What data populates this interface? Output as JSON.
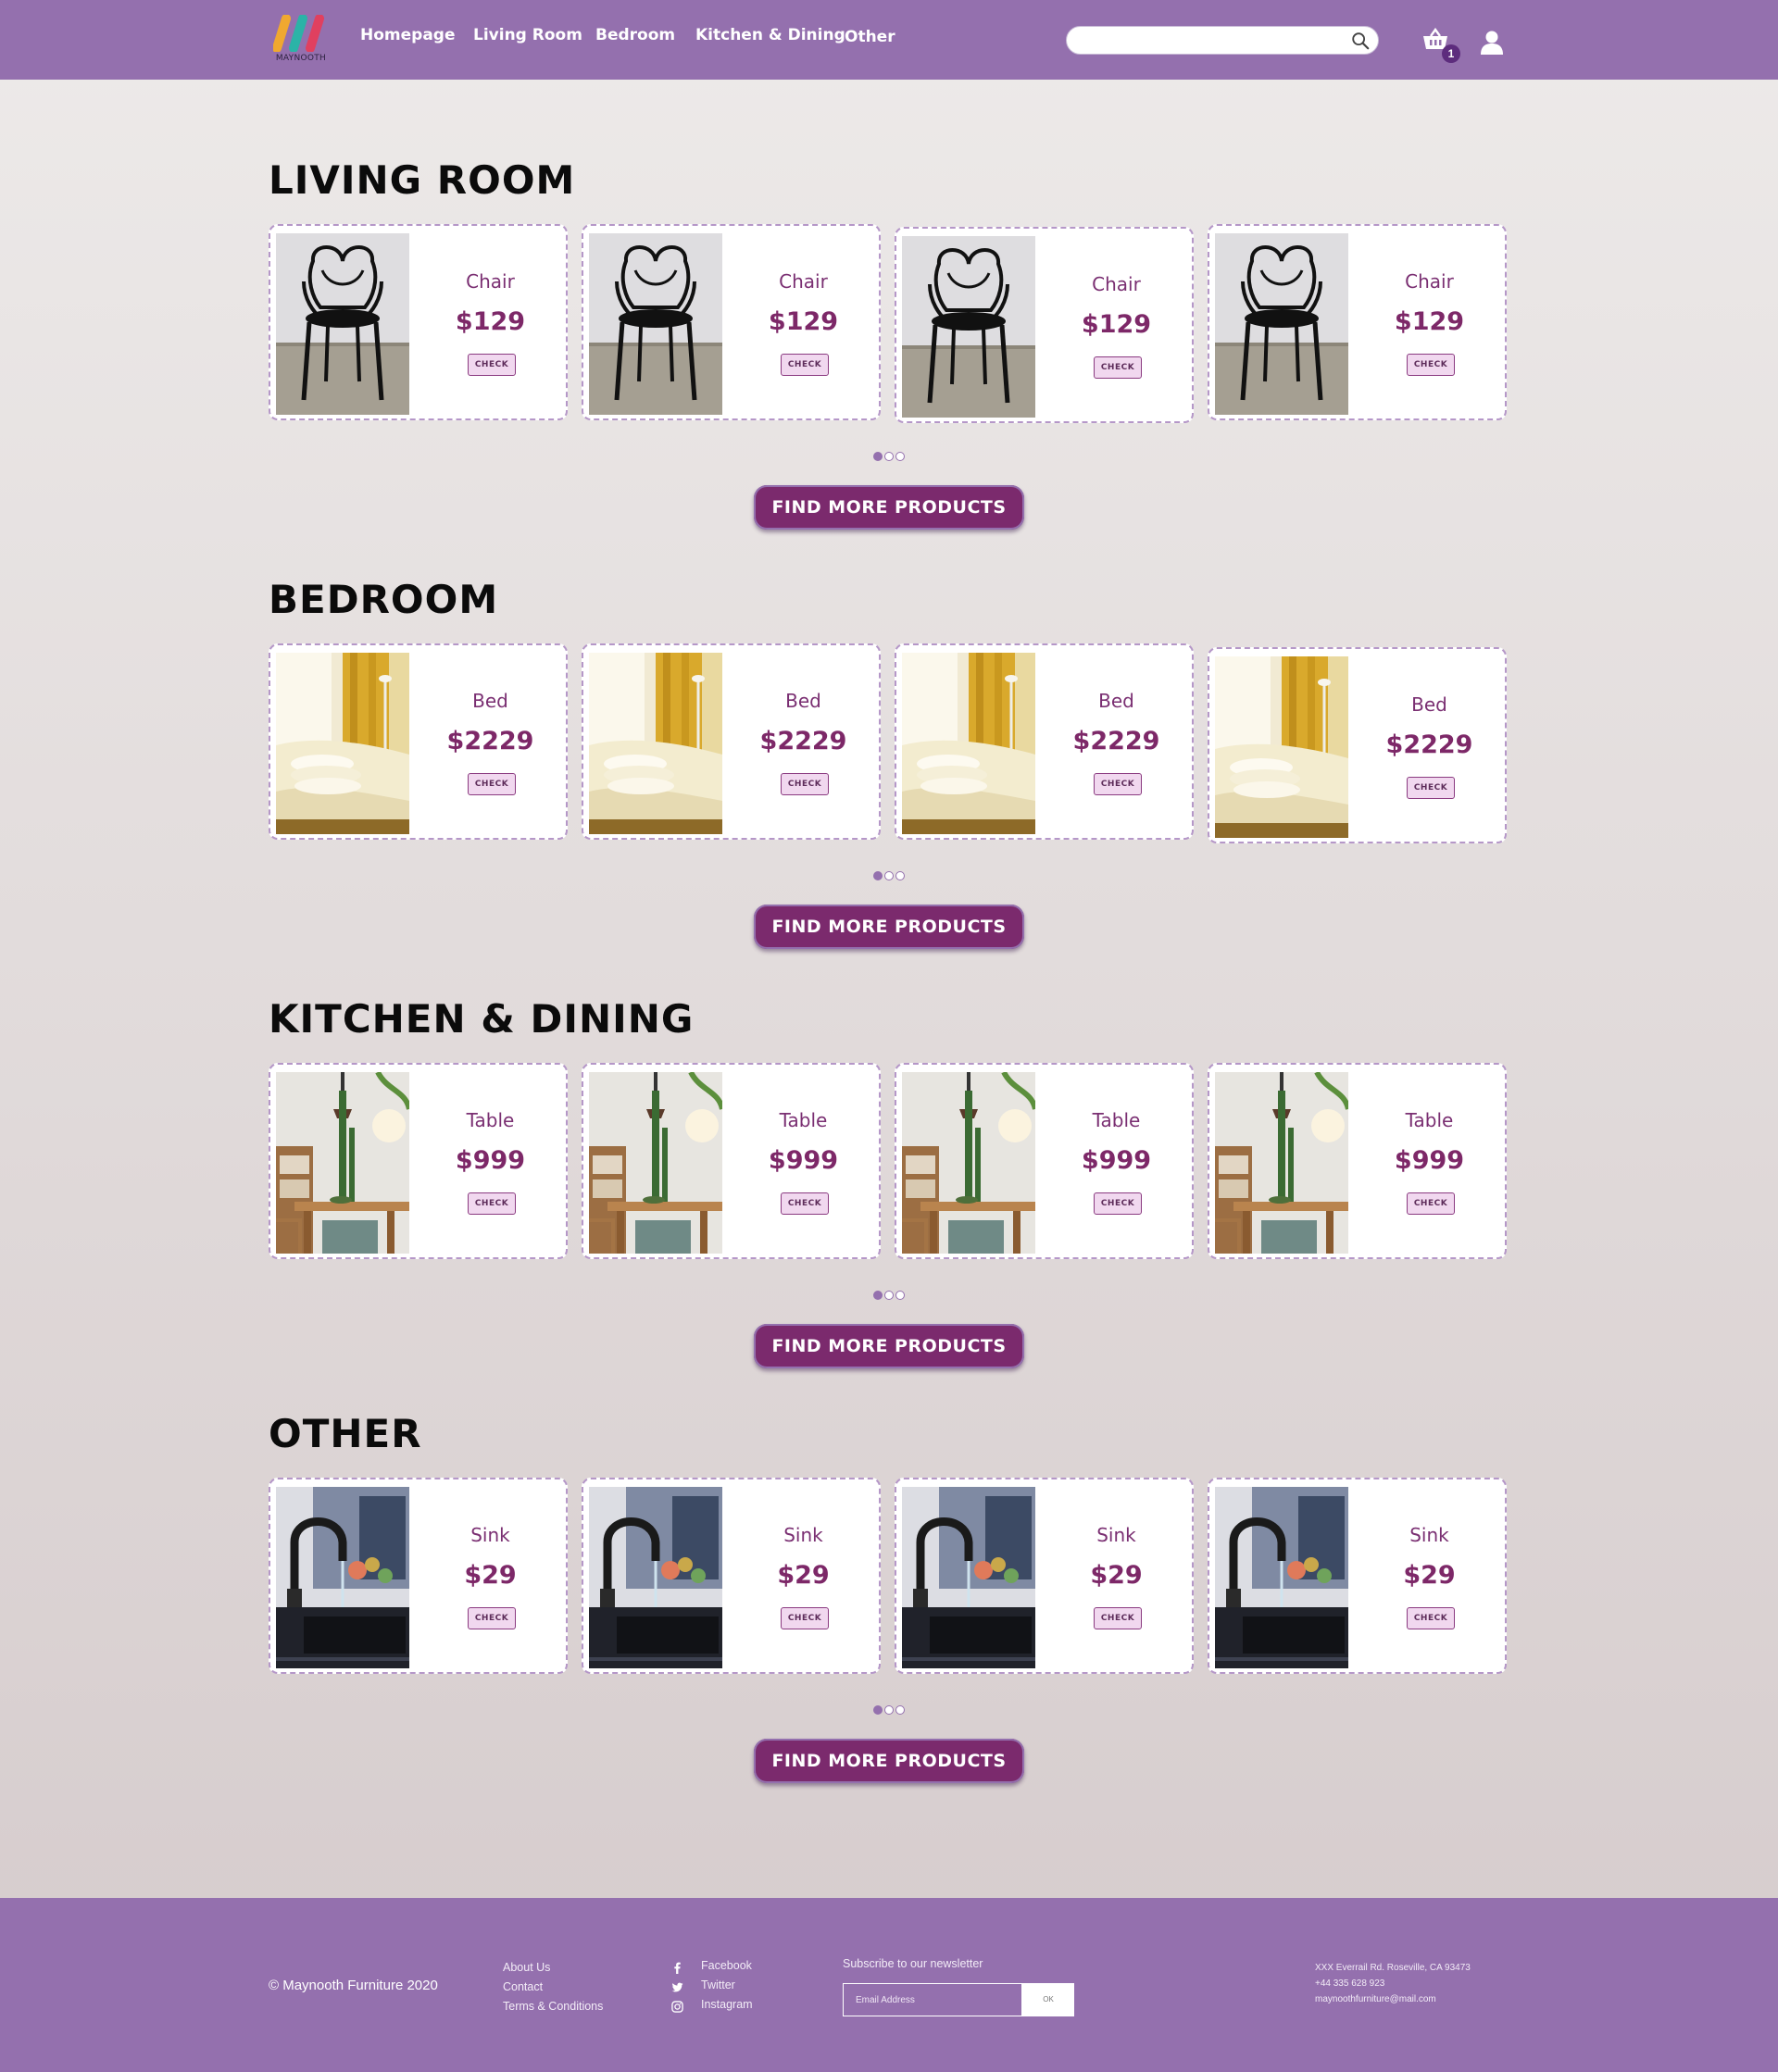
{
  "brand": {
    "name": "MAYNOOTH",
    "colors": {
      "header": "#9470ae",
      "accent": "#7b2a6d"
    }
  },
  "nav": {
    "items": [
      "Homepage",
      "Living Room",
      "Bedroom",
      "Kitchen & Dining",
      "Other"
    ]
  },
  "search": {
    "placeholder": "",
    "icon": "search-icon"
  },
  "cart": {
    "count": "1",
    "icon": "basket-icon"
  },
  "user": {
    "icon": "user-icon"
  },
  "sections": [
    {
      "title": "LIVING ROOM",
      "products": [
        {
          "name": "Chair",
          "price": "$129",
          "check": "CHECK"
        },
        {
          "name": "Chair",
          "price": "$129",
          "check": "CHECK"
        },
        {
          "name": "Chair",
          "price": "$129",
          "check": "CHECK"
        },
        {
          "name": "Chair",
          "price": "$129",
          "check": "CHECK"
        }
      ],
      "button": "FIND MORE PRODUCTS"
    },
    {
      "title": "BEDROOM",
      "products": [
        {
          "name": "Bed",
          "price": "$2229",
          "check": "CHECK"
        },
        {
          "name": "Bed",
          "price": "$2229",
          "check": "CHECK"
        },
        {
          "name": "Bed",
          "price": "$2229",
          "check": "CHECK"
        },
        {
          "name": "Bed",
          "price": "$2229",
          "check": "CHECK"
        }
      ],
      "button": "FIND MORE PRODUCTS"
    },
    {
      "title": "KITCHEN & DINING",
      "products": [
        {
          "name": "Table",
          "price": "$999",
          "check": "CHECK"
        },
        {
          "name": "Table",
          "price": "$999",
          "check": "CHECK"
        },
        {
          "name": "Table",
          "price": "$999",
          "check": "CHECK"
        },
        {
          "name": "Table",
          "price": "$999",
          "check": "CHECK"
        }
      ],
      "button": "FIND MORE PRODUCTS"
    },
    {
      "title": "OTHER",
      "products": [
        {
          "name": "Sink",
          "price": "$29",
          "check": "CHECK"
        },
        {
          "name": "Sink",
          "price": "$29",
          "check": "CHECK"
        },
        {
          "name": "Sink",
          "price": "$29",
          "check": "CHECK"
        },
        {
          "name": "Sink",
          "price": "$29",
          "check": "CHECK"
        }
      ],
      "button": "FIND MORE PRODUCTS"
    }
  ],
  "footer": {
    "copyright": "© Maynooth Furniture 2020",
    "links": [
      "About Us",
      "Contact",
      "Terms & Conditions"
    ],
    "social": [
      {
        "label": "Facebook",
        "icon": "facebook-icon"
      },
      {
        "label": "Twitter",
        "icon": "twitter-icon"
      },
      {
        "label": "Instagram",
        "icon": "instagram-icon"
      }
    ],
    "newsletter_title": "Subscribe to our newsletter",
    "email_placeholder": "Email Address",
    "ok_label": "OK",
    "address": [
      "XXX Everrail Rd. Roseville, CA 93473",
      "+44 335 628 923",
      "maynoothfurniture@mail.com"
    ]
  }
}
